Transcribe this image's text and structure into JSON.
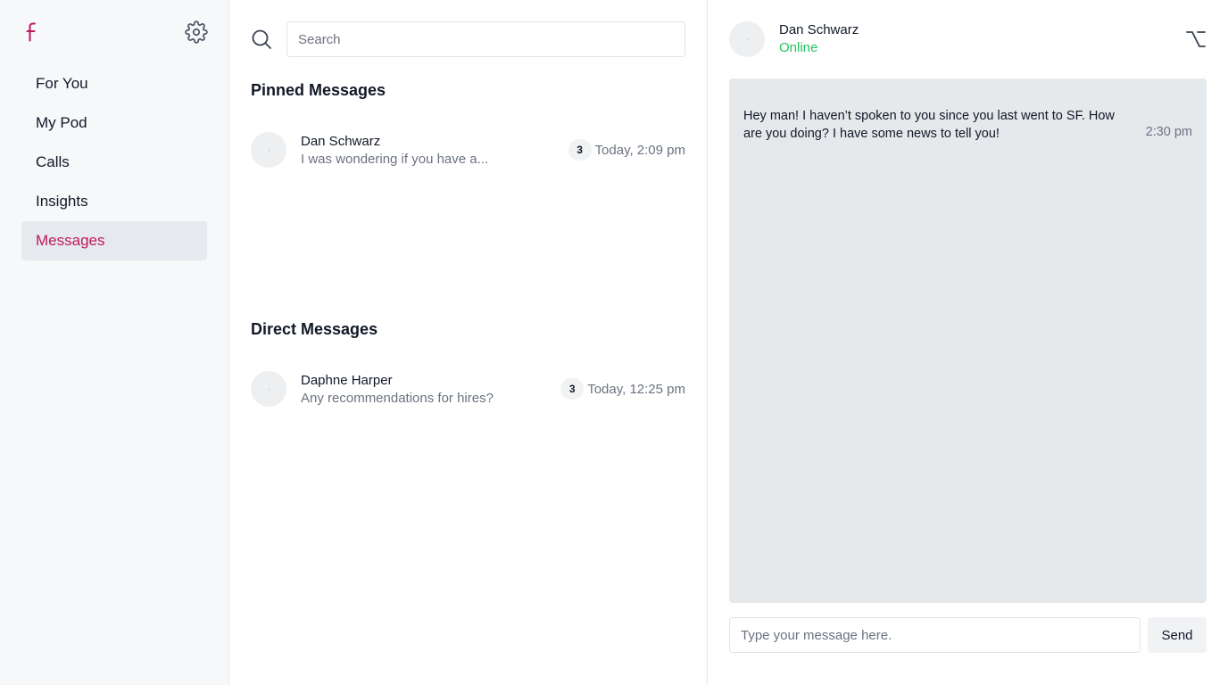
{
  "colors": {
    "accent": "#be185d",
    "online": "#22c55e",
    "muted_text": "#6b7280",
    "sidebar_bg": "#f7f8fa",
    "active_item_bg": "#e6e9ed",
    "chat_bg": "#e6e9ec"
  },
  "sidebar": {
    "logo_icon": "facebook-logo-icon",
    "settings_icon": "gear-icon",
    "nav": [
      {
        "label": "For You",
        "active": false
      },
      {
        "label": "My Pod",
        "active": false
      },
      {
        "label": "Calls",
        "active": false
      },
      {
        "label": "Insights",
        "active": false
      },
      {
        "label": "Messages",
        "active": true
      }
    ]
  },
  "list": {
    "search": {
      "icon": "search-icon",
      "placeholder": "Search",
      "value": ""
    },
    "pinned": {
      "title": "Pinned Messages",
      "items": [
        {
          "name": "Dan Schwarz",
          "preview": "I was wondering if you have a...",
          "unread": "3",
          "time": "Today, 2:09 pm"
        }
      ]
    },
    "direct": {
      "title": "Direct Messages",
      "items": [
        {
          "name": "Daphne Harper",
          "preview": "Any recommendations for hires?",
          "unread": "3",
          "time": "Today, 12:25 pm"
        }
      ]
    }
  },
  "chat": {
    "contact_name": "Dan Schwarz",
    "status": "Online",
    "option_icon": "option-key-icon",
    "messages": [
      {
        "text": "Hey man! I haven’t spoken to you since you last went to SF. How are you doing? I have some news to tell you!",
        "time": "2:30 pm"
      }
    ],
    "composer": {
      "placeholder": "Type your message here.",
      "value": "",
      "send_label": "Send"
    }
  }
}
